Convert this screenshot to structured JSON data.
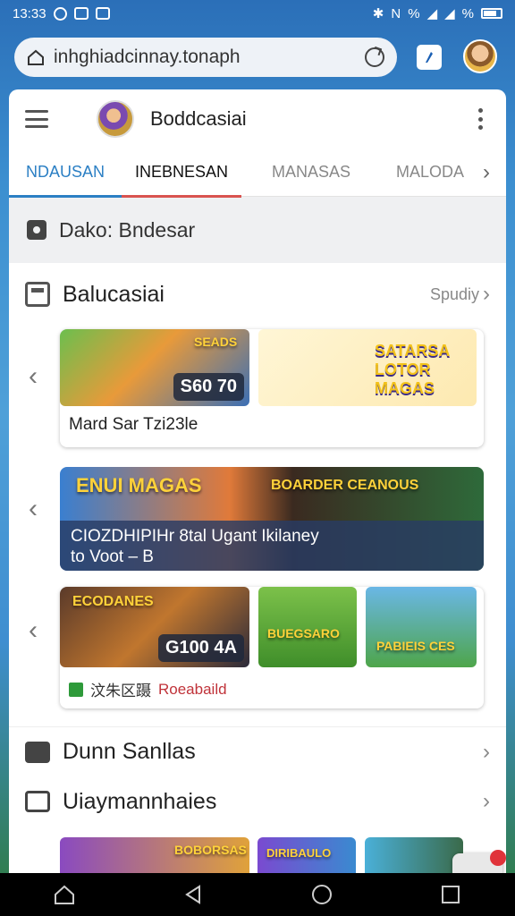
{
  "status_bar": {
    "time": "13:33",
    "battery_text": "%"
  },
  "browser": {
    "url": "inhghiadcinnay.tonaph"
  },
  "app": {
    "title": "Boddcasiai",
    "tabs": [
      "NDAUSAN",
      "INEBNESAN",
      "MANASAS",
      "MALODA"
    ]
  },
  "location": {
    "text": "Dako: Bndesar"
  },
  "section1": {
    "title": "Balucasiai",
    "more": "Spudiy"
  },
  "cards": {
    "row1_main_caption": "Mard Sar Tzi23le",
    "row1_main_price": "S60 70",
    "row1_main_art": "SEADS",
    "row1_side_art": "SATARSA LOTOR MAGAS",
    "banner_art_left": "ENUI MAGAS",
    "banner_art_right": "BOARDER CEANOUS",
    "banner_text_line1": "CIOZDHIPIHr 8tal Ugant Ikilaney",
    "banner_text_line2": "to Voot – B",
    "row3_main_art": "ECODANES",
    "row3_main_price": "G100 4A",
    "row3_tile2_art": "BUEGSARO",
    "row3_tile3_art": "PABIEIS CES",
    "row3_caption": "Roeabaild",
    "row3_caption_prefix": "汶朱区蹑"
  },
  "list": [
    {
      "title": "Dunn Sanllas"
    },
    {
      "title": "Uiaymannhaies"
    }
  ],
  "bottom_thumbs": [
    "BOBORSAS",
    "DIRIBAULO"
  ],
  "colors": {
    "accent_blue": "#2b7fc4",
    "accent_red": "#d9534f"
  }
}
